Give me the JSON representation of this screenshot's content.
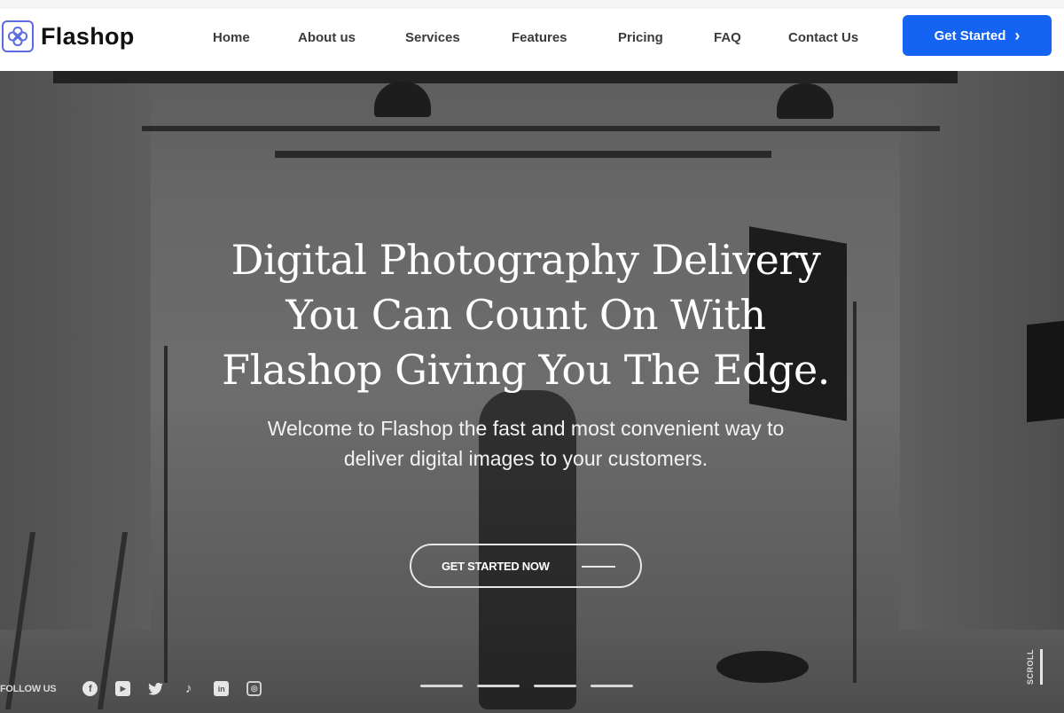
{
  "header": {
    "brand": "Flashop",
    "logo_icon": "flower-swirl-logo-icon",
    "nav": [
      {
        "label": "Home"
      },
      {
        "label": "About us"
      },
      {
        "label": "Services"
      },
      {
        "label": "Features"
      },
      {
        "label": "Pricing"
      },
      {
        "label": "FAQ"
      },
      {
        "label": "Contact Us"
      }
    ],
    "cta_label": "Get Started",
    "cta_icon": "chevron-right-icon",
    "cta_color": "#1463f3"
  },
  "hero": {
    "headline_lines": [
      "Digital Photography Delivery",
      "You Can Count On With",
      "Flashop Giving You The Edge."
    ],
    "subtitle_lines": [
      "Welcome to Flashop the fast and most convenient way to",
      "deliver digital images to your customers."
    ],
    "cta_label": "GET STARTED NOW",
    "follow_label": "FOLLOW US",
    "social": [
      {
        "name": "facebook",
        "icon": "facebook-icon",
        "glyph": "f"
      },
      {
        "name": "youtube",
        "icon": "youtube-icon",
        "glyph": "▶"
      },
      {
        "name": "twitter",
        "icon": "twitter-icon",
        "glyph": "🐦"
      },
      {
        "name": "tiktok",
        "icon": "tiktok-icon",
        "glyph": "♪"
      },
      {
        "name": "linkedin",
        "icon": "linkedin-icon",
        "glyph": "in"
      },
      {
        "name": "instagram",
        "icon": "instagram-icon",
        "glyph": "◎"
      }
    ],
    "slides_count": 4,
    "scroll_label": "SCROLL"
  }
}
